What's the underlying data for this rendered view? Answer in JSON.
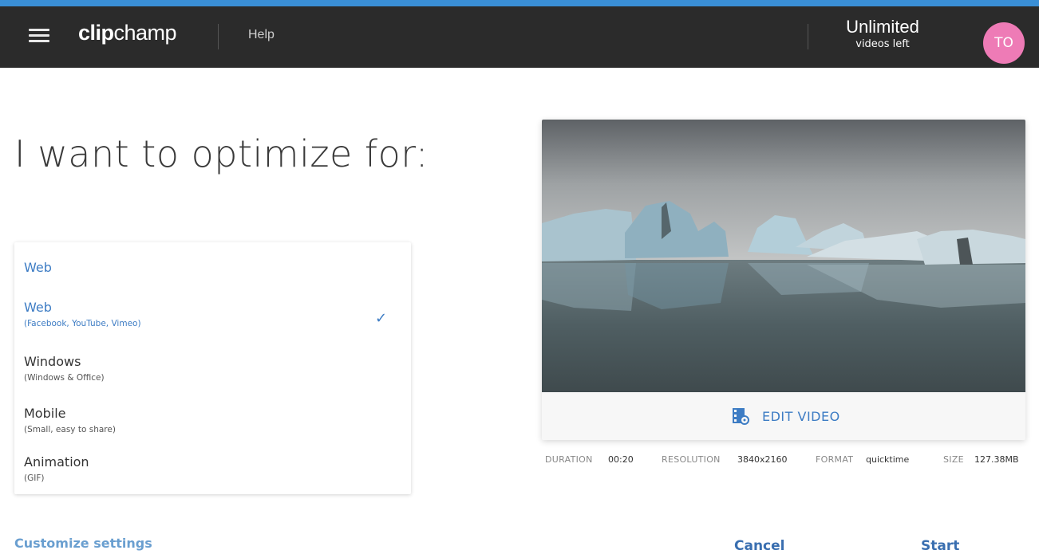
{
  "header": {
    "logo_bold": "clip",
    "logo_light": "champ",
    "help_label": "Help",
    "quota_main": "Unlimited",
    "quota_sub": "videos left",
    "avatar_initials": "TO",
    "avatar_color": "#ee7bb6",
    "accent_color": "#3a8fd6"
  },
  "main": {
    "heading": "I want to optimize for:",
    "selected_option": "Web",
    "options": [
      {
        "name": "Web",
        "desc": "(Facebook, YouTube, Vimeo)",
        "selected": true
      },
      {
        "name": "Windows",
        "desc": "(Windows & Office)",
        "selected": false
      },
      {
        "name": "Mobile",
        "desc": "(Small, easy to share)",
        "selected": false
      },
      {
        "name": "Animation",
        "desc": "(GIF)",
        "selected": false
      }
    ],
    "customize_label": "Customize settings"
  },
  "preview": {
    "edit_label": "EDIT VIDEO",
    "duration_label": "DURATION",
    "duration_value": "00:20",
    "resolution_label": "RESOLUTION",
    "resolution_value": "3840x2160",
    "format_label": "FORMAT",
    "format_value": "quicktime",
    "size_label": "SIZE",
    "size_value": "127.38MB"
  },
  "actions": {
    "cancel_label": "Cancel",
    "start_label": "Start"
  }
}
